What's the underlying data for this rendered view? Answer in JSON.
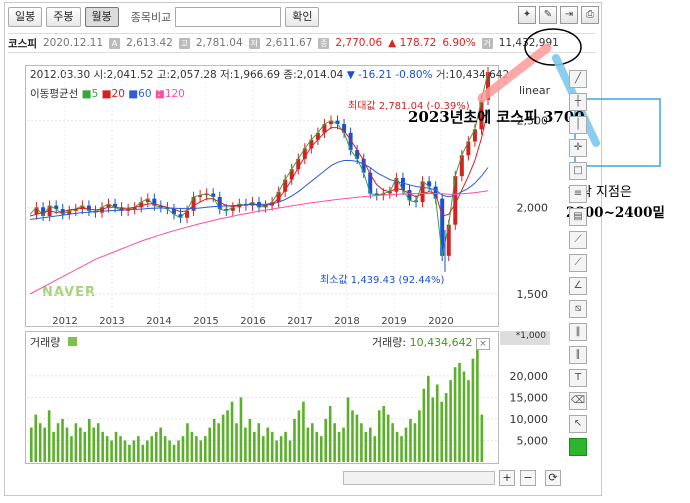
{
  "toolbar": {
    "daily": "일봉",
    "weekly": "주봉",
    "monthly": "월봉",
    "compare_label": "종목비교",
    "confirm": "확인"
  },
  "info": {
    "name": "코스피",
    "date": "2020.12.11",
    "high": "2,613.42",
    "open": "2,781.04",
    "low": "2,611.67",
    "close": "2,770.06",
    "change": "▲ 178.72",
    "pct": "6.90%",
    "volume": "11,432,991"
  },
  "ohlc": {
    "date": "2012.03.30",
    "open_label": "시:",
    "open": "2,041.52",
    "high_label": "고:",
    "high": "2,057.28",
    "low_label": "저:",
    "low": "1,966.69",
    "close_label": "종:",
    "close": "2,014.04",
    "arrow": "▼",
    "change": "-16.21",
    "pct": "-0.80%",
    "vol_label": "거:",
    "vol": "10,434,642"
  },
  "ma": {
    "label": "이동평균선",
    "m5": "5",
    "m20": "20",
    "m60": "60",
    "m120": "120"
  },
  "scale": "linear",
  "max_label": "최대값 2,781.04 (-0.39%)",
  "min_label": "최소값 1,439.43 (92.44%)",
  "watermark": "NAVER",
  "volume": {
    "label": "거래량",
    "right_label": "거래량:",
    "right_value": "10,434,642",
    "unit": "*1,000"
  },
  "annotations": {
    "a1": "2023년초에 코스피 3700",
    "a2": "하락 지점은",
    "a3": "2800~2400밑"
  },
  "colors": {
    "up": "#d22222",
    "down": "#1a4fd6",
    "ma5": "#3aa63a",
    "ma20": "#d22222",
    "ma60": "#2a5fd6",
    "ma120": "#ff4fa0",
    "volume": "#5bb02a"
  },
  "chart_data": [
    {
      "type": "line",
      "title": "",
      "xlabel": "",
      "ylabel": "",
      "x_ticks": [
        "2012",
        "2013",
        "2014",
        "2015",
        "2016",
        "2017",
        "2018",
        "2019",
        "2020"
      ],
      "y_ticks": [
        1500,
        2000,
        2500
      ],
      "ylim": [
        1350,
        2850
      ],
      "series": [
        {
          "name": "5",
          "values": [
            1960,
            2000,
            1950,
            2010,
            1990,
            1960,
            1980,
            1990,
            2010,
            1980,
            1970,
            2000,
            2020,
            2000,
            1980,
            1990,
            2000,
            2030,
            2050,
            2010,
            2000,
            1990,
            1960,
            1940,
            1980,
            2060,
            2070,
            2080,
            2060,
            1990,
            1980,
            2000,
            2020,
            2010,
            2030,
            2000,
            2010,
            2030,
            2090,
            2160,
            2220,
            2280,
            2340,
            2390,
            2430,
            2480,
            2500,
            2480,
            2430,
            2330,
            2280,
            2200,
            2080,
            2070,
            2080,
            2090,
            2170,
            2100,
            2040,
            2030,
            2150,
            2120,
            2050,
            1720,
            1900,
            2180,
            2300,
            2380,
            2450,
            2620,
            2780
          ]
        },
        {
          "name": "20",
          "values": [
            1950,
            1960,
            1970,
            1980,
            1970,
            1975,
            1985,
            1990,
            1995,
            1990,
            1985,
            1990,
            2000,
            2000,
            1995,
            1995,
            2000,
            2010,
            2020,
            2020,
            2010,
            2000,
            1990,
            1975,
            1980,
            2010,
            2030,
            2050,
            2050,
            2030,
            2010,
            2005,
            2010,
            2015,
            2020,
            2015,
            2010,
            2020,
            2050,
            2100,
            2160,
            2230,
            2290,
            2350,
            2390,
            2430,
            2460,
            2460,
            2440,
            2390,
            2330,
            2270,
            2190,
            2130,
            2100,
            2090,
            2110,
            2100,
            2080,
            2060,
            2080,
            2090,
            2080,
            1950,
            1960,
            2020,
            2100,
            2180,
            2270,
            2400,
            2560
          ]
        },
        {
          "name": "60",
          "values": [
            1930,
            1935,
            1940,
            1945,
            1950,
            1955,
            1960,
            1965,
            1970,
            1972,
            1975,
            1978,
            1980,
            1982,
            1984,
            1986,
            1988,
            1990,
            1993,
            1995,
            1996,
            1996,
            1995,
            1993,
            1992,
            1993,
            1996,
            2000,
            2004,
            2006,
            2008,
            2010,
            2012,
            2014,
            2016,
            2017,
            2018,
            2020,
            2030,
            2045,
            2065,
            2090,
            2120,
            2150,
            2180,
            2210,
            2240,
            2260,
            2270,
            2270,
            2265,
            2250,
            2230,
            2200,
            2180,
            2160,
            2150,
            2140,
            2130,
            2120,
            2115,
            2110,
            2100,
            2070,
            2060,
            2070,
            2090,
            2110,
            2140,
            2180,
            2230
          ]
        },
        {
          "name": "120",
          "values": [
            1500,
            1520,
            1540,
            1560,
            1580,
            1600,
            1620,
            1640,
            1660,
            1680,
            1700,
            1715,
            1730,
            1745,
            1760,
            1775,
            1790,
            1805,
            1818,
            1830,
            1842,
            1854,
            1865,
            1876,
            1886,
            1896,
            1906,
            1915,
            1924,
            1933,
            1941,
            1949,
            1957,
            1964,
            1971,
            1978,
            1984,
            1990,
            1996,
            2002,
            2008,
            2014,
            2020,
            2026,
            2031,
            2036,
            2041,
            2046,
            2050,
            2054,
            2058,
            2062,
            2065,
            2068,
            2071,
            2073,
            2075,
            2077,
            2078,
            2079,
            2080,
            2080,
            2080,
            2078,
            2076,
            2076,
            2078,
            2081,
            2085,
            2090,
            2096
          ]
        }
      ]
    },
    {
      "type": "bar",
      "title": "",
      "ylabel": "",
      "y_ticks": [
        5000,
        10000,
        15000,
        20000
      ],
      "ylim": [
        0,
        26000
      ],
      "values": [
        8000,
        11000,
        9000,
        8000,
        12000,
        7000,
        9000,
        10000,
        8000,
        6000,
        9000,
        8000,
        7000,
        10000,
        8000,
        9000,
        7000,
        6000,
        5000,
        7000,
        6000,
        5000,
        4000,
        5000,
        6000,
        4000,
        5000,
        6000,
        7000,
        8000,
        6000,
        5000,
        4000,
        5000,
        6000,
        9000,
        7000,
        6000,
        5000,
        6000,
        8000,
        10000,
        9000,
        11000,
        12000,
        14000,
        9000,
        15000,
        8000,
        10000,
        7000,
        9000,
        6000,
        8000,
        7000,
        5000,
        6000,
        7000,
        5000,
        10000,
        12000,
        14000,
        8000,
        9000,
        7000,
        6000,
        10000,
        13000,
        9000,
        7000,
        8000,
        15000,
        12000,
        11000,
        9000,
        7000,
        8000,
        6000,
        12000,
        13000,
        11000,
        9000,
        7000,
        6000,
        8000,
        10000,
        9000,
        12000,
        17000,
        20000,
        15000,
        18000,
        14000,
        16000,
        19000,
        22000,
        23000,
        21000,
        19000,
        24000,
        26000,
        11000
      ]
    }
  ]
}
